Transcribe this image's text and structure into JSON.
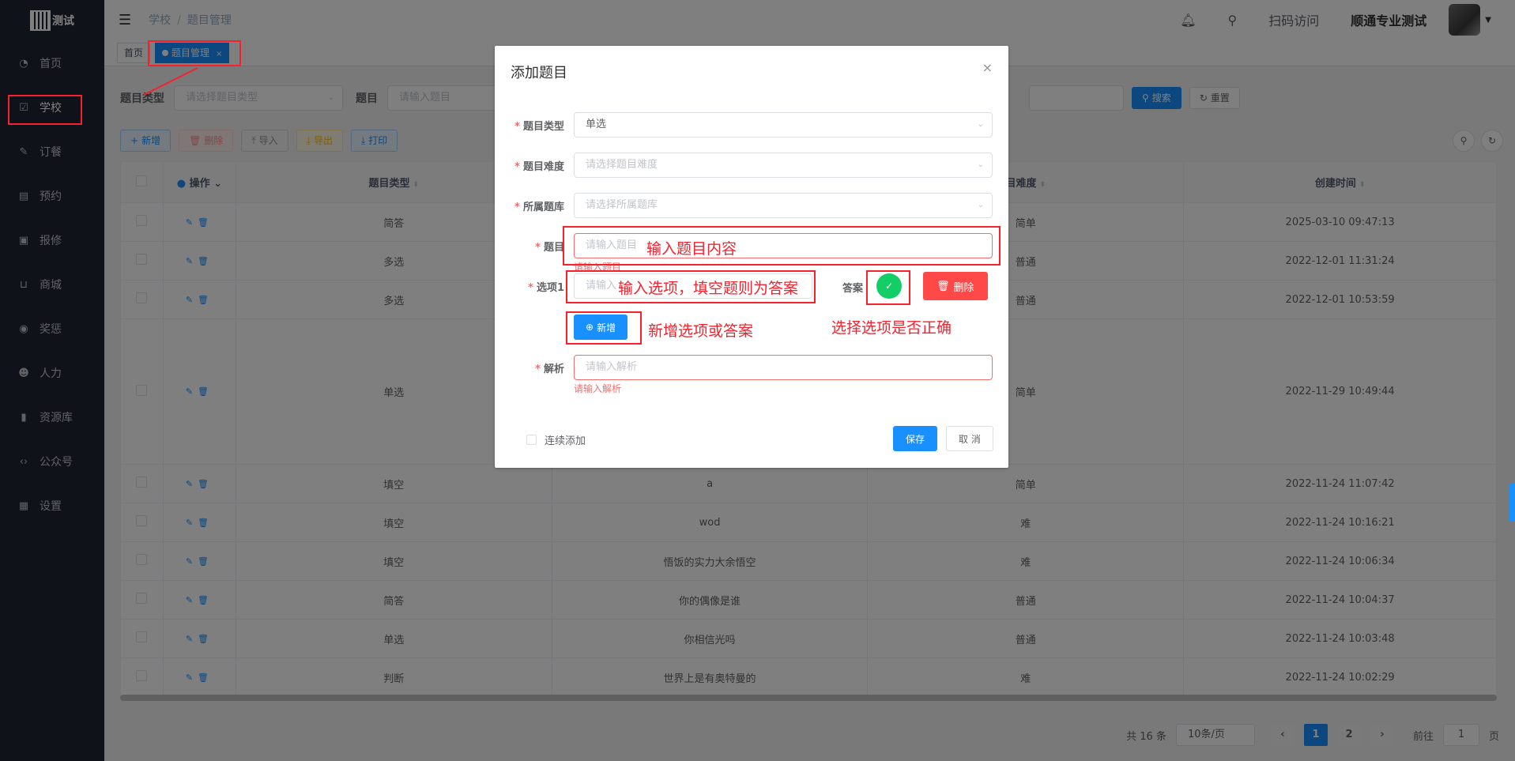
{
  "sidebar": {
    "logo_text": "测试",
    "items": [
      {
        "label": "首页",
        "icon": "dashboard-icon"
      },
      {
        "label": "学校",
        "icon": "checkbox-icon"
      },
      {
        "label": "订餐",
        "icon": "edit-icon"
      },
      {
        "label": "预约",
        "icon": "calendar-icon"
      },
      {
        "label": "报修",
        "icon": "briefcase-icon"
      },
      {
        "label": "商城",
        "icon": "cart-icon"
      },
      {
        "label": "奖惩",
        "icon": "eye-icon"
      },
      {
        "label": "人力",
        "icon": "peoples-icon"
      },
      {
        "label": "资源库",
        "icon": "chart-icon"
      },
      {
        "label": "公众号",
        "icon": "code-icon"
      },
      {
        "label": "设置",
        "icon": "settings-icon"
      }
    ]
  },
  "navbar": {
    "breadcrumb": [
      "学校",
      "题目管理"
    ],
    "scan_visit": "扫码访问",
    "user_name": "顺通专业测试"
  },
  "tags": {
    "home": "首页",
    "active": "题目管理",
    "close": "×"
  },
  "search": {
    "type_label": "题目类型",
    "type_placeholder": "请选择题目类型",
    "question_label": "题目",
    "question_placeholder": "请输入题目",
    "search_btn": "搜索",
    "reset_btn": "重置"
  },
  "toolbar": {
    "add": "新增",
    "delete": "删除",
    "import": "导入",
    "export": "导出",
    "print": "打印"
  },
  "table": {
    "headers": {
      "ops": "操作",
      "type": "题目类型",
      "difficulty": "目难度",
      "created": "创建时间"
    },
    "rows": [
      {
        "type": "简答",
        "question": "",
        "difficulty": "简单",
        "created": "2025-03-10 09:47:13"
      },
      {
        "type": "多选",
        "question": "",
        "difficulty": "普通",
        "created": "2022-12-01 11:31:24"
      },
      {
        "type": "多选",
        "question": "",
        "difficulty": "普通",
        "created": "2022-12-01 10:53:59"
      },
      {
        "type": "单选",
        "question": "",
        "difficulty": "简单",
        "created": "2022-11-29 10:49:44"
      },
      {
        "type": "填空",
        "question": "a",
        "difficulty": "简单",
        "created": "2022-11-24 11:07:42"
      },
      {
        "type": "填空",
        "question": "wod",
        "difficulty": "难",
        "created": "2022-11-24 10:16:21"
      },
      {
        "type": "填空",
        "question": "悟饭的实力大余悟空",
        "difficulty": "难",
        "created": "2022-11-24 10:06:34"
      },
      {
        "type": "简答",
        "question": "你的偶像是谁",
        "difficulty": "普通",
        "created": "2022-11-24 10:04:37"
      },
      {
        "type": "单选",
        "question": "你相信光吗",
        "difficulty": "普通",
        "created": "2022-11-24 10:03:48"
      },
      {
        "type": "判断",
        "question": "世界上是有奥特曼的",
        "difficulty": "难",
        "created": "2022-11-24 10:02:29"
      }
    ]
  },
  "pager": {
    "total": "共 16 条",
    "size": "10条/页",
    "prev": "‹",
    "next": "›",
    "pages": [
      "1",
      "2"
    ],
    "goto": "前往",
    "goto_value": "1",
    "page_unit": "页"
  },
  "dialog": {
    "title": "添加题目",
    "close": "×",
    "type_label": "题目类型",
    "type_value": "单选",
    "difficulty_label": "题目难度",
    "difficulty_placeholder": "请选择题目难度",
    "bank_label": "所属题库",
    "bank_placeholder": "请选择所属题库",
    "question_label": "题目",
    "question_placeholder": "请输入题目",
    "question_error": "请输入题目",
    "option_label": "选项1",
    "option_placeholder": "请输入",
    "answer_label": "答案",
    "delete_option": "删除",
    "add_option": "新增",
    "analysis_label": "解析",
    "analysis_placeholder": "请输入解析",
    "analysis_error": "请输入解析",
    "continuous_add": "连续添加",
    "save": "保存",
    "cancel": "取 消"
  },
  "annotations": {
    "question_hint": "输入题目内容",
    "option_hint": "输入选项，填空题则为答案",
    "add_hint": "新增选项或答案",
    "answer_hint": "选择选项是否正确"
  },
  "colors": {
    "primary": "#1890ff",
    "success": "#13ce66",
    "danger": "#ff4949",
    "annotation": "#f5222d",
    "sidebar": "#1f2430"
  }
}
